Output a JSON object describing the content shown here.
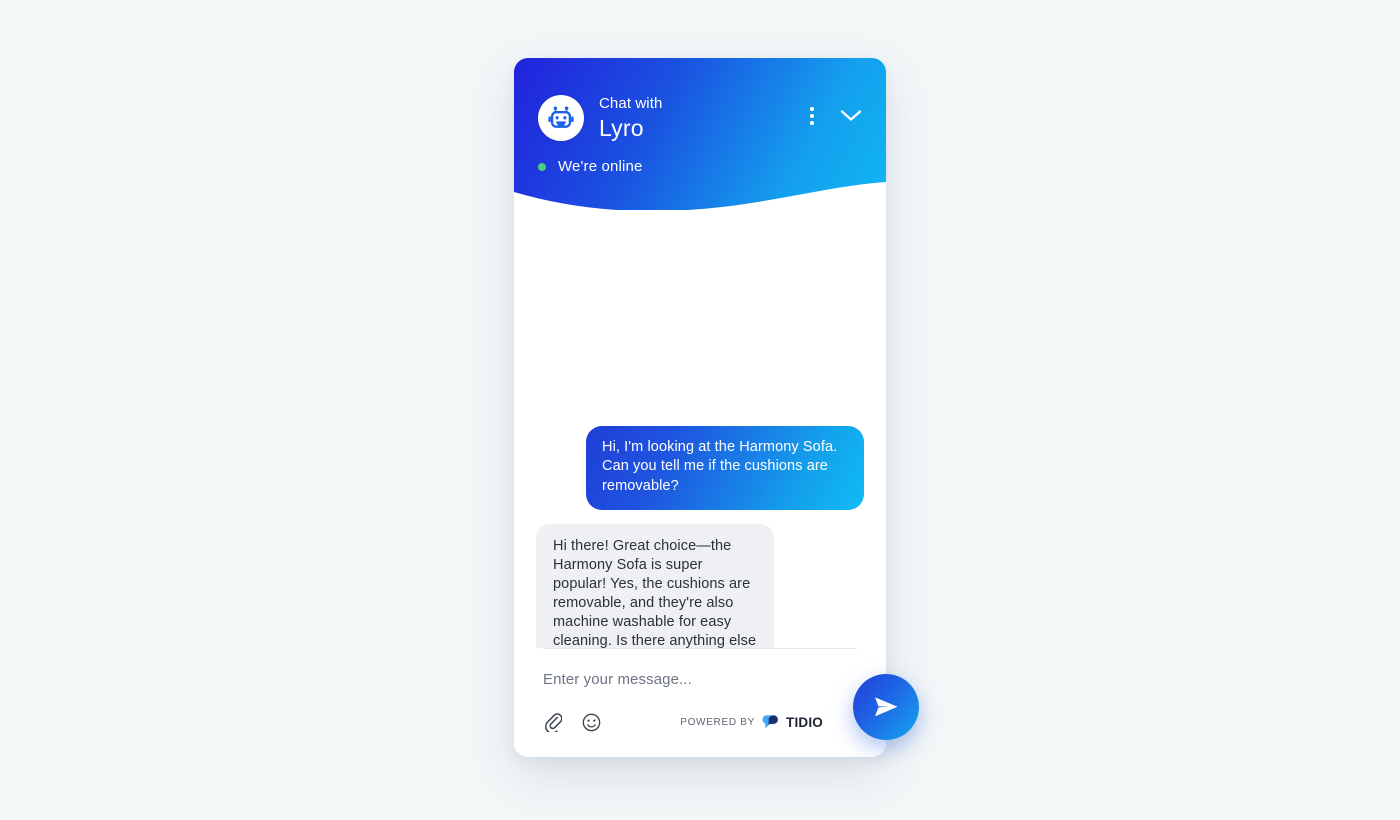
{
  "widget": {
    "header": {
      "eyebrow": "Chat with",
      "title": "Lyro",
      "avatar_icon": "robot-avatar-icon",
      "menu_icon": "more-vertical-icon",
      "collapse_icon": "chevron-down-icon",
      "status_text": "We're online",
      "status_color": "#4ad07d",
      "gradient_from": "#2222dd",
      "gradient_to": "#0fb7f2"
    },
    "messages": [
      {
        "sender": "user",
        "text": "Hi, I'm looking at the Harmony Sofa. Can you tell me if the cushions are removable?"
      },
      {
        "sender": "bot",
        "text": "Hi there! Great choice—the Harmony Sofa is super popular! Yes, the cushions are removable, and they're also machine washable for easy cleaning. Is there anything else you'd like to know about it?"
      }
    ],
    "composer": {
      "input_value": "",
      "input_placeholder": "Enter your message...",
      "attach_icon": "paperclip-icon",
      "emoji_icon": "smiley-icon",
      "send_icon": "send-paper-plane-icon",
      "powered_by_label": "POWERED BY",
      "brand_name": "TIDIO",
      "brand_icon": "tidio-logo-icon"
    }
  }
}
